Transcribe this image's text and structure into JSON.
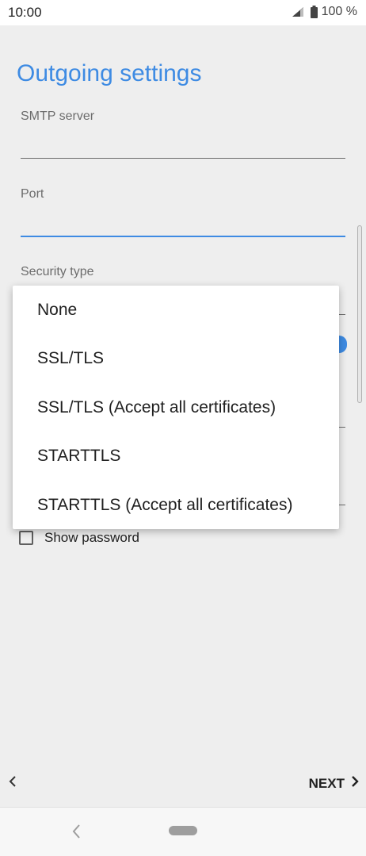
{
  "status_bar": {
    "time": "10:00",
    "battery_text": "100 %"
  },
  "page": {
    "title": "Outgoing settings"
  },
  "fields": {
    "smtp_label": "SMTP server",
    "port_label": "Port",
    "security_label": "Security type"
  },
  "security_menu": {
    "options": [
      "None",
      "SSL/TLS",
      "SSL/TLS (Accept all certificates)",
      "STARTTLS",
      "STARTTLS (Accept all certificates)"
    ]
  },
  "show_password": {
    "label": "Show password",
    "checked": false
  },
  "footer": {
    "next_label": "NEXT"
  },
  "colors": {
    "accent": "#3e8be3"
  },
  "icons": {
    "signal": "signal-icon",
    "battery": "battery-icon",
    "back": "chevron-left-icon",
    "next": "chevron-right-icon"
  }
}
